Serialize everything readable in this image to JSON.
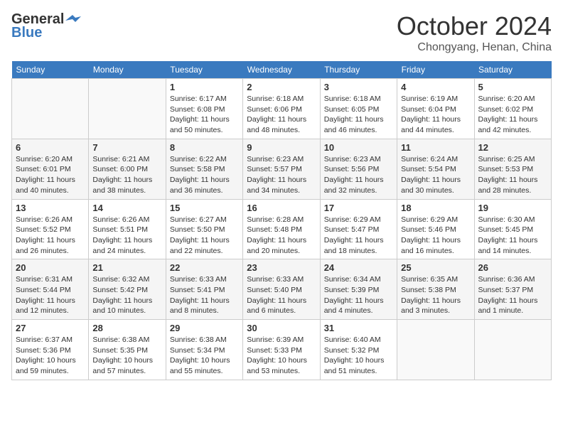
{
  "header": {
    "logo_general": "General",
    "logo_blue": "Blue",
    "month": "October 2024",
    "location": "Chongyang, Henan, China"
  },
  "weekdays": [
    "Sunday",
    "Monday",
    "Tuesday",
    "Wednesday",
    "Thursday",
    "Friday",
    "Saturday"
  ],
  "weeks": [
    [
      {
        "day": "",
        "sunrise": "",
        "sunset": "",
        "daylight": ""
      },
      {
        "day": "",
        "sunrise": "",
        "sunset": "",
        "daylight": ""
      },
      {
        "day": "1",
        "sunrise": "Sunrise: 6:17 AM",
        "sunset": "Sunset: 6:08 PM",
        "daylight": "Daylight: 11 hours and 50 minutes."
      },
      {
        "day": "2",
        "sunrise": "Sunrise: 6:18 AM",
        "sunset": "Sunset: 6:06 PM",
        "daylight": "Daylight: 11 hours and 48 minutes."
      },
      {
        "day": "3",
        "sunrise": "Sunrise: 6:18 AM",
        "sunset": "Sunset: 6:05 PM",
        "daylight": "Daylight: 11 hours and 46 minutes."
      },
      {
        "day": "4",
        "sunrise": "Sunrise: 6:19 AM",
        "sunset": "Sunset: 6:04 PM",
        "daylight": "Daylight: 11 hours and 44 minutes."
      },
      {
        "day": "5",
        "sunrise": "Sunrise: 6:20 AM",
        "sunset": "Sunset: 6:02 PM",
        "daylight": "Daylight: 11 hours and 42 minutes."
      }
    ],
    [
      {
        "day": "6",
        "sunrise": "Sunrise: 6:20 AM",
        "sunset": "Sunset: 6:01 PM",
        "daylight": "Daylight: 11 hours and 40 minutes."
      },
      {
        "day": "7",
        "sunrise": "Sunrise: 6:21 AM",
        "sunset": "Sunset: 6:00 PM",
        "daylight": "Daylight: 11 hours and 38 minutes."
      },
      {
        "day": "8",
        "sunrise": "Sunrise: 6:22 AM",
        "sunset": "Sunset: 5:58 PM",
        "daylight": "Daylight: 11 hours and 36 minutes."
      },
      {
        "day": "9",
        "sunrise": "Sunrise: 6:23 AM",
        "sunset": "Sunset: 5:57 PM",
        "daylight": "Daylight: 11 hours and 34 minutes."
      },
      {
        "day": "10",
        "sunrise": "Sunrise: 6:23 AM",
        "sunset": "Sunset: 5:56 PM",
        "daylight": "Daylight: 11 hours and 32 minutes."
      },
      {
        "day": "11",
        "sunrise": "Sunrise: 6:24 AM",
        "sunset": "Sunset: 5:54 PM",
        "daylight": "Daylight: 11 hours and 30 minutes."
      },
      {
        "day": "12",
        "sunrise": "Sunrise: 6:25 AM",
        "sunset": "Sunset: 5:53 PM",
        "daylight": "Daylight: 11 hours and 28 minutes."
      }
    ],
    [
      {
        "day": "13",
        "sunrise": "Sunrise: 6:26 AM",
        "sunset": "Sunset: 5:52 PM",
        "daylight": "Daylight: 11 hours and 26 minutes."
      },
      {
        "day": "14",
        "sunrise": "Sunrise: 6:26 AM",
        "sunset": "Sunset: 5:51 PM",
        "daylight": "Daylight: 11 hours and 24 minutes."
      },
      {
        "day": "15",
        "sunrise": "Sunrise: 6:27 AM",
        "sunset": "Sunset: 5:50 PM",
        "daylight": "Daylight: 11 hours and 22 minutes."
      },
      {
        "day": "16",
        "sunrise": "Sunrise: 6:28 AM",
        "sunset": "Sunset: 5:48 PM",
        "daylight": "Daylight: 11 hours and 20 minutes."
      },
      {
        "day": "17",
        "sunrise": "Sunrise: 6:29 AM",
        "sunset": "Sunset: 5:47 PM",
        "daylight": "Daylight: 11 hours and 18 minutes."
      },
      {
        "day": "18",
        "sunrise": "Sunrise: 6:29 AM",
        "sunset": "Sunset: 5:46 PM",
        "daylight": "Daylight: 11 hours and 16 minutes."
      },
      {
        "day": "19",
        "sunrise": "Sunrise: 6:30 AM",
        "sunset": "Sunset: 5:45 PM",
        "daylight": "Daylight: 11 hours and 14 minutes."
      }
    ],
    [
      {
        "day": "20",
        "sunrise": "Sunrise: 6:31 AM",
        "sunset": "Sunset: 5:44 PM",
        "daylight": "Daylight: 11 hours and 12 minutes."
      },
      {
        "day": "21",
        "sunrise": "Sunrise: 6:32 AM",
        "sunset": "Sunset: 5:42 PM",
        "daylight": "Daylight: 11 hours and 10 minutes."
      },
      {
        "day": "22",
        "sunrise": "Sunrise: 6:33 AM",
        "sunset": "Sunset: 5:41 PM",
        "daylight": "Daylight: 11 hours and 8 minutes."
      },
      {
        "day": "23",
        "sunrise": "Sunrise: 6:33 AM",
        "sunset": "Sunset: 5:40 PM",
        "daylight": "Daylight: 11 hours and 6 minutes."
      },
      {
        "day": "24",
        "sunrise": "Sunrise: 6:34 AM",
        "sunset": "Sunset: 5:39 PM",
        "daylight": "Daylight: 11 hours and 4 minutes."
      },
      {
        "day": "25",
        "sunrise": "Sunrise: 6:35 AM",
        "sunset": "Sunset: 5:38 PM",
        "daylight": "Daylight: 11 hours and 3 minutes."
      },
      {
        "day": "26",
        "sunrise": "Sunrise: 6:36 AM",
        "sunset": "Sunset: 5:37 PM",
        "daylight": "Daylight: 11 hours and 1 minute."
      }
    ],
    [
      {
        "day": "27",
        "sunrise": "Sunrise: 6:37 AM",
        "sunset": "Sunset: 5:36 PM",
        "daylight": "Daylight: 10 hours and 59 minutes."
      },
      {
        "day": "28",
        "sunrise": "Sunrise: 6:38 AM",
        "sunset": "Sunset: 5:35 PM",
        "daylight": "Daylight: 10 hours and 57 minutes."
      },
      {
        "day": "29",
        "sunrise": "Sunrise: 6:38 AM",
        "sunset": "Sunset: 5:34 PM",
        "daylight": "Daylight: 10 hours and 55 minutes."
      },
      {
        "day": "30",
        "sunrise": "Sunrise: 6:39 AM",
        "sunset": "Sunset: 5:33 PM",
        "daylight": "Daylight: 10 hours and 53 minutes."
      },
      {
        "day": "31",
        "sunrise": "Sunrise: 6:40 AM",
        "sunset": "Sunset: 5:32 PM",
        "daylight": "Daylight: 10 hours and 51 minutes."
      },
      {
        "day": "",
        "sunrise": "",
        "sunset": "",
        "daylight": ""
      },
      {
        "day": "",
        "sunrise": "",
        "sunset": "",
        "daylight": ""
      }
    ]
  ]
}
